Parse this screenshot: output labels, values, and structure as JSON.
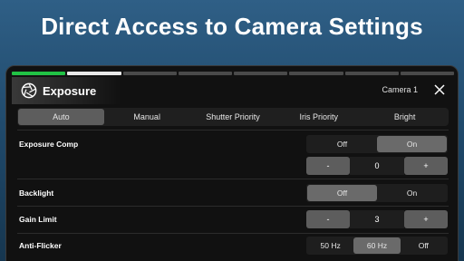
{
  "headline": "Direct Access to Camera Settings",
  "panel": {
    "title": "Exposure",
    "camera": "Camera 1"
  },
  "modes": [
    {
      "label": "Auto",
      "selected": true
    },
    {
      "label": "Manual",
      "selected": false
    },
    {
      "label": "Shutter Priority",
      "selected": false
    },
    {
      "label": "Iris Priority",
      "selected": false
    },
    {
      "label": "Bright",
      "selected": false
    }
  ],
  "exposure_comp": {
    "label": "Exposure Comp",
    "options": [
      "Off",
      "On"
    ],
    "selected": "On",
    "stepper": {
      "minus": "-",
      "value": "0",
      "plus": "+"
    }
  },
  "backlight": {
    "label": "Backlight",
    "options": [
      "Off",
      "On"
    ],
    "selected": "Off"
  },
  "gain_limit": {
    "label": "Gain Limit",
    "stepper": {
      "minus": "-",
      "value": "3",
      "plus": "+"
    }
  },
  "anti_flicker": {
    "label": "Anti-Flicker",
    "options": [
      "50 Hz",
      "60 Hz",
      "Off"
    ],
    "selected": "60 Hz"
  },
  "colors": {
    "accent": "#21c245",
    "background": "#1e4768",
    "panel": "#111111",
    "selected": "#6a6a6a"
  },
  "icons": {
    "panel": "aperture-icon",
    "close": "close-icon"
  }
}
